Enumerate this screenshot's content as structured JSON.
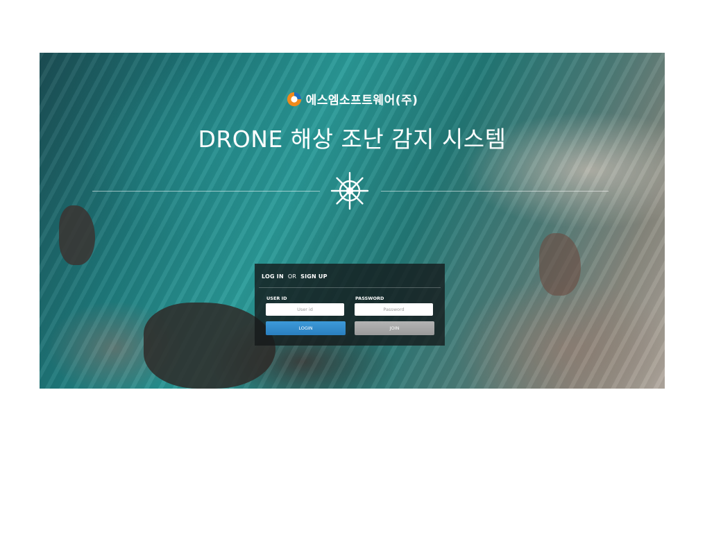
{
  "brand": {
    "name": "에스엠소프트웨어(주)"
  },
  "page": {
    "title": "DRONE 해상 조난 감지 시스템"
  },
  "login": {
    "header_login": "LOG IN",
    "header_or": "OR",
    "header_signup": "SIGN UP",
    "user_id_label": "USER ID",
    "user_id_placeholder": "User id",
    "password_label": "PASSWORD",
    "password_placeholder": "Password",
    "login_button": "LOGIN",
    "join_button": "JOIN"
  },
  "icons": {
    "logo": "brand-logo-icon",
    "wheel": "ship-wheel-icon"
  },
  "colors": {
    "login_button": "#2a85c5",
    "join_button": "#a6a6a6",
    "panel": "#14181a"
  }
}
